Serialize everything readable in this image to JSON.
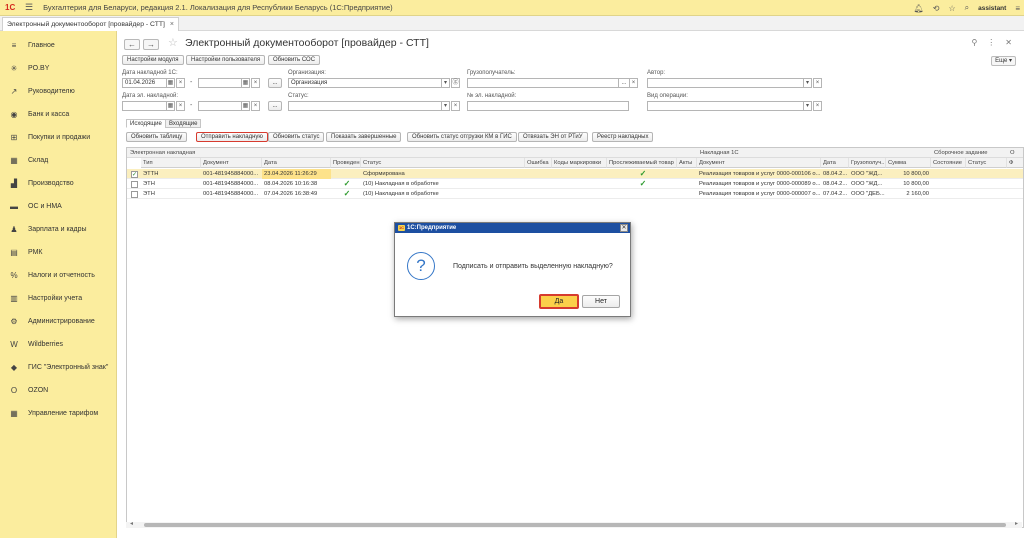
{
  "app": {
    "logo_text": "1С",
    "title": "Бухгалтерия для Беларуси, редакция 2.1. Локализация для Республики Беларусь  (1С:Предприятие)",
    "user": "assistant"
  },
  "tab": {
    "label": "Электронный документооборот [провайдер - СТТ]",
    "close": "×"
  },
  "sidebar": {
    "items": [
      {
        "label": "Главное",
        "icon": "menu-icon",
        "glyph": "≡"
      },
      {
        "label": "PO.BY",
        "icon": "star-icon",
        "glyph": "✳"
      },
      {
        "label": "Руководителю",
        "icon": "chart-line-icon",
        "glyph": "↗"
      },
      {
        "label": "Банк и касса",
        "icon": "bank-icon",
        "glyph": "◉"
      },
      {
        "label": "Покупки и продажи",
        "icon": "cart-icon",
        "glyph": "⊞"
      },
      {
        "label": "Склад",
        "icon": "warehouse-icon",
        "glyph": "▦"
      },
      {
        "label": "Производство",
        "icon": "factory-icon",
        "glyph": "▟"
      },
      {
        "label": "ОС и НМА",
        "icon": "truck-icon",
        "glyph": "▬"
      },
      {
        "label": "Зарплата и кадры",
        "icon": "person-icon",
        "glyph": "♟"
      },
      {
        "label": "РМК",
        "icon": "cash-register-icon",
        "glyph": "▤"
      },
      {
        "label": "Налоги и отчетность",
        "icon": "percent-icon",
        "glyph": "%"
      },
      {
        "label": "Настройки учета",
        "icon": "book-icon",
        "glyph": "▥"
      },
      {
        "label": "Администрирование",
        "icon": "gear-icon",
        "glyph": "⚙"
      },
      {
        "label": "Wildberries",
        "icon": "wildberries-icon",
        "glyph": "W"
      },
      {
        "label": "ГИС \"Электронный знак\"",
        "icon": "diamond-icon",
        "glyph": "◆"
      },
      {
        "label": "OZON",
        "icon": "ozon-icon",
        "glyph": "O"
      },
      {
        "label": "Управление тарифом",
        "icon": "grid-icon",
        "glyph": "▦"
      }
    ]
  },
  "page": {
    "title": "Электронный документооборот [провайдер - СТТ]",
    "more": "Еще ▾",
    "top_buttons": [
      "Настройки модуля",
      "Настройки пользователя",
      "Обновить СОС"
    ]
  },
  "filters": {
    "invoice_date_label": "Дата накладной 1С:",
    "invoice_date_from": "01.04.2026",
    "einvoice_date_label": "Дата эл. накладной:",
    "organization_label": "Организация:",
    "organization_value": "Организация",
    "status_label": "Статус:",
    "consignee_label": "Грузополучатель:",
    "einvoice_no_label": "№ эл. накладной:",
    "author_label": "Автор:",
    "operation_label": "Вид операции:",
    "dash": "-",
    "dots": "...",
    "clear": "×",
    "cal": "▦",
    "drop": "▾"
  },
  "subtabs": [
    "Исходящие",
    "Входящие"
  ],
  "actions": [
    "Обновить таблицу",
    "Отправить накладную",
    "Обновить статус",
    "Показать завершенные",
    "Обновить статус отгрузки КМ в ГИС",
    "Отвязать ЭН от РТиУ",
    "Реестр накладных"
  ],
  "table": {
    "groups": [
      "Электронная накладная",
      "Накладная 1С",
      "Сборочное задание",
      "О"
    ],
    "headers": [
      "Тип",
      "Документ",
      "Дата",
      "Проведен",
      "Статус",
      "Ошибка",
      "Коды маркировки",
      "Прослеживаемый товар",
      "Акты",
      "Документ",
      "Дата",
      "Грузополуч...",
      "Сумма",
      "Состояние",
      "Статус",
      "Ф"
    ],
    "rows": [
      {
        "checked": true,
        "type": "ЭТТН",
        "doc": "001-481945884000...",
        "date": "23.04.2026 11:26:29",
        "posted": "",
        "status": "Сформирована",
        "traced": "✓",
        "doc1c": "Реализация товаров и услуг 0000-000106 о...",
        "date1c": "08.04.2...",
        "consignee": "ООО \"ЖД...",
        "sum": "10 800,00"
      },
      {
        "checked": false,
        "type": "ЭТН",
        "doc": "001-481945884000...",
        "date": "08.04.2026 10:16:38",
        "posted": "✓",
        "status": "(10) Накладная в обработке",
        "traced": "✓",
        "doc1c": "Реализация товаров и услуг 0000-000089 о...",
        "date1c": "08.04.2...",
        "consignee": "ООО \"ЖД...",
        "sum": "10 800,00"
      },
      {
        "checked": false,
        "type": "ЭТН",
        "doc": "001-481945884000...",
        "date": "07.04.2026 16:38:49",
        "posted": "✓",
        "status": "(10) Накладная в обработке",
        "traced": "",
        "doc1c": "Реализация товаров и услуг 0000-000007 о...",
        "date1c": "07.04.2...",
        "consignee": "ООО \"ДЕБ...",
        "sum": "2 160,00"
      }
    ]
  },
  "dialog": {
    "title": "1С:Предприятие",
    "message": "Подписать и отправить выделенную накладную?",
    "yes": "Да",
    "no": "Нет",
    "q": "?"
  }
}
